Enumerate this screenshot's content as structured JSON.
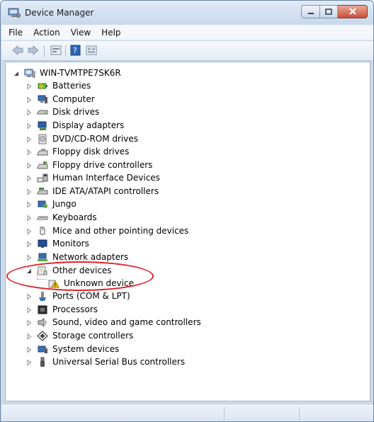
{
  "window": {
    "title": "Device Manager",
    "title_icon": "device-manager-icon",
    "caption_buttons": [
      "minimize-icon",
      "maximize-icon",
      "close-icon"
    ]
  },
  "menu": {
    "items": [
      "File",
      "Action",
      "View",
      "Help"
    ]
  },
  "toolbar": {
    "buttons": [
      "back-arrow-icon",
      "forward-arrow-icon",
      "properties-icon",
      "help-icon",
      "view-icon"
    ]
  },
  "tree": {
    "root": "WIN-TVMTPE7SK6R",
    "nodes": [
      {
        "label": "Batteries",
        "icon": "battery-icon"
      },
      {
        "label": "Computer",
        "icon": "computer-icon"
      },
      {
        "label": "Disk drives",
        "icon": "disk-drive-icon"
      },
      {
        "label": "Display adapters",
        "icon": "display-adapter-icon"
      },
      {
        "label": "DVD/CD-ROM drives",
        "icon": "dvd-drive-icon"
      },
      {
        "label": "Floppy disk drives",
        "icon": "floppy-disk-icon"
      },
      {
        "label": "Floppy drive controllers",
        "icon": "floppy-controller-icon"
      },
      {
        "label": "Human Interface Devices",
        "icon": "hid-icon"
      },
      {
        "label": "IDE ATA/ATAPI controllers",
        "icon": "ide-controller-icon"
      },
      {
        "label": "Jungo",
        "icon": "jungo-icon"
      },
      {
        "label": "Keyboards",
        "icon": "keyboard-icon"
      },
      {
        "label": "Mice and other pointing devices",
        "icon": "mouse-icon"
      },
      {
        "label": "Monitors",
        "icon": "monitor-icon"
      },
      {
        "label": "Network adapters",
        "icon": "network-adapter-icon"
      },
      {
        "label": "Other devices",
        "icon": "other-devices-icon",
        "expanded": true
      },
      {
        "label": "Unknown device",
        "icon": "unknown-device-warning-icon",
        "child": true
      },
      {
        "label": "Ports (COM & LPT)",
        "icon": "port-icon"
      },
      {
        "label": "Processors",
        "icon": "processor-icon"
      },
      {
        "label": "Sound, video and game controllers",
        "icon": "sound-icon"
      },
      {
        "label": "Storage controllers",
        "icon": "storage-controller-icon"
      },
      {
        "label": "System devices",
        "icon": "system-device-icon"
      },
      {
        "label": "Universal Serial Bus controllers",
        "icon": "usb-icon"
      }
    ]
  },
  "colors": {
    "highlight_ring": "#e0202a",
    "window_frame": "#cfdcea",
    "close_button": "#c7503a"
  }
}
